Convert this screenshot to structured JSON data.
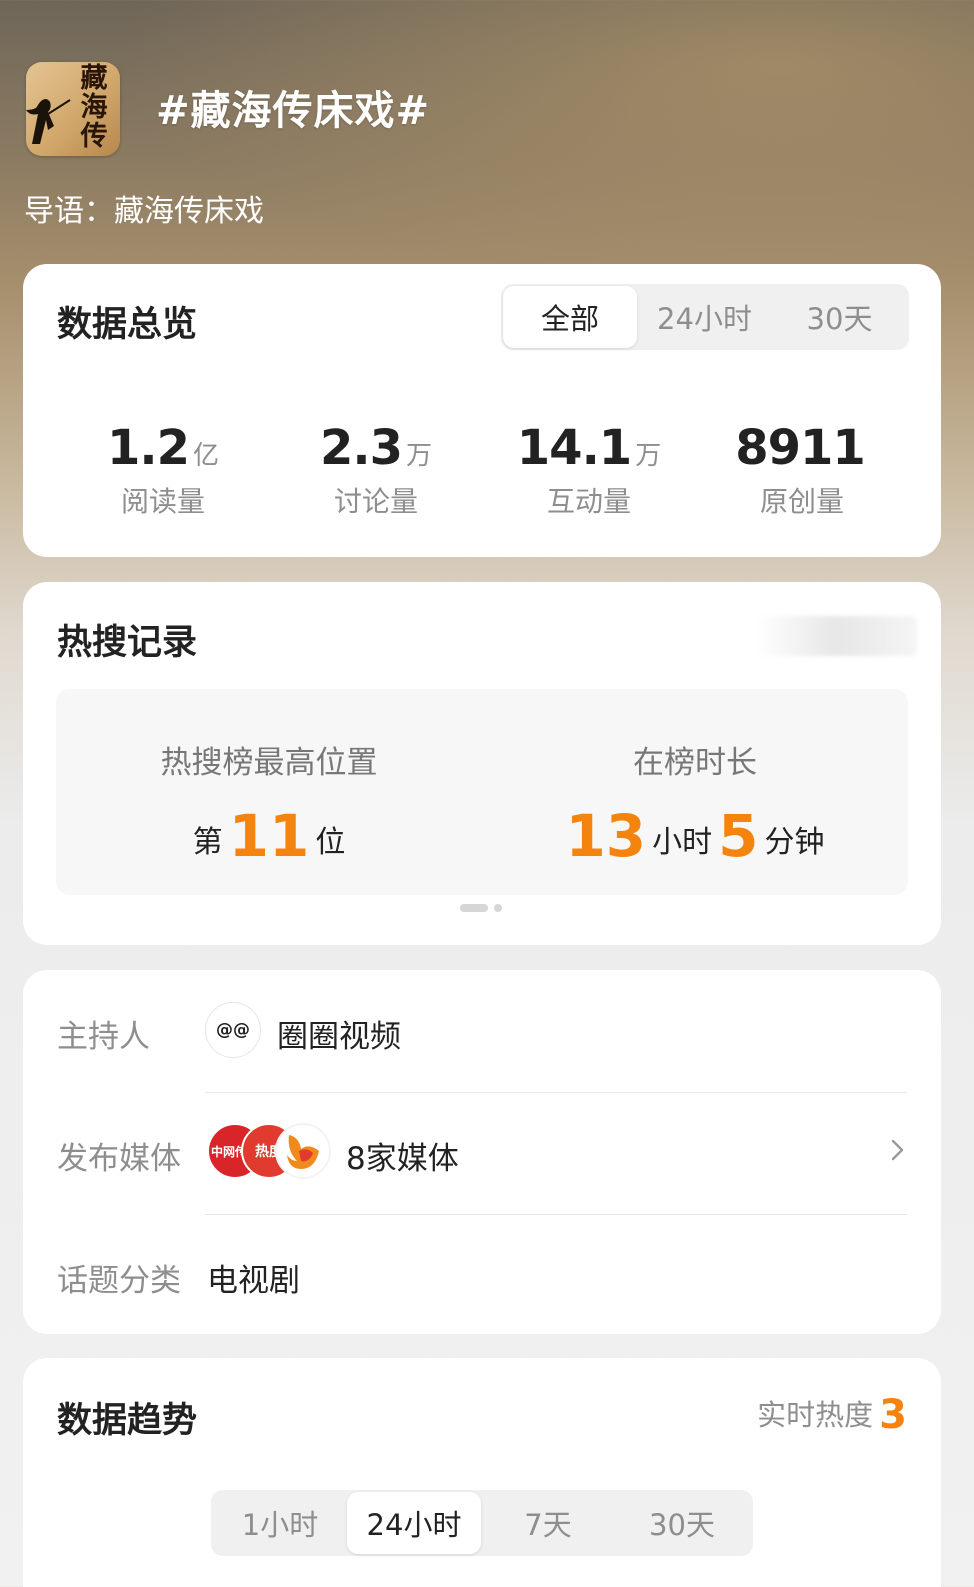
{
  "header": {
    "logo_text": "藏海传",
    "topic_title": "#藏海传床戏#",
    "lead_label": "导语：",
    "lead_text": "藏海传床戏"
  },
  "overview": {
    "title": "数据总览",
    "tabs": [
      {
        "label": "全部",
        "active": true
      },
      {
        "label": "24小时",
        "active": false
      },
      {
        "label": "30天",
        "active": false
      }
    ],
    "stats": [
      {
        "value": "1.2",
        "unit": "亿",
        "label": "阅读量"
      },
      {
        "value": "2.3",
        "unit": "万",
        "label": "讨论量"
      },
      {
        "value": "14.1",
        "unit": "万",
        "label": "互动量"
      },
      {
        "value": "8911",
        "unit": "",
        "label": "原创量"
      }
    ]
  },
  "hot_search": {
    "title": "热搜记录",
    "peak_label": "热搜榜最高位置",
    "peak_prefix": "第",
    "peak_value": "11",
    "peak_suffix": "位",
    "duration_label": "在榜时长",
    "duration_hours": "13",
    "hours_unit": "小时",
    "duration_minutes": "5",
    "minutes_unit": "分钟"
  },
  "info": {
    "host_label": "主持人",
    "host_avatar_text": "@@",
    "host_name": "圈圈视频",
    "media_label": "发布媒体",
    "media_logo_1": "中网传播",
    "media_logo_2": "热度",
    "media_count": "8家媒体",
    "category_label": "话题分类",
    "category_value": "电视剧"
  },
  "trend": {
    "title": "数据趋势",
    "live_heat_label": "实时热度",
    "live_heat_value": "3",
    "tabs": [
      {
        "label": "1小时",
        "active": false
      },
      {
        "label": "24小时",
        "active": true
      },
      {
        "label": "7天",
        "active": false
      },
      {
        "label": "30天",
        "active": false
      }
    ]
  },
  "colors": {
    "accent": "#f5840f",
    "muted_text": "#8e8e8e",
    "card_bg": "#ffffff"
  }
}
